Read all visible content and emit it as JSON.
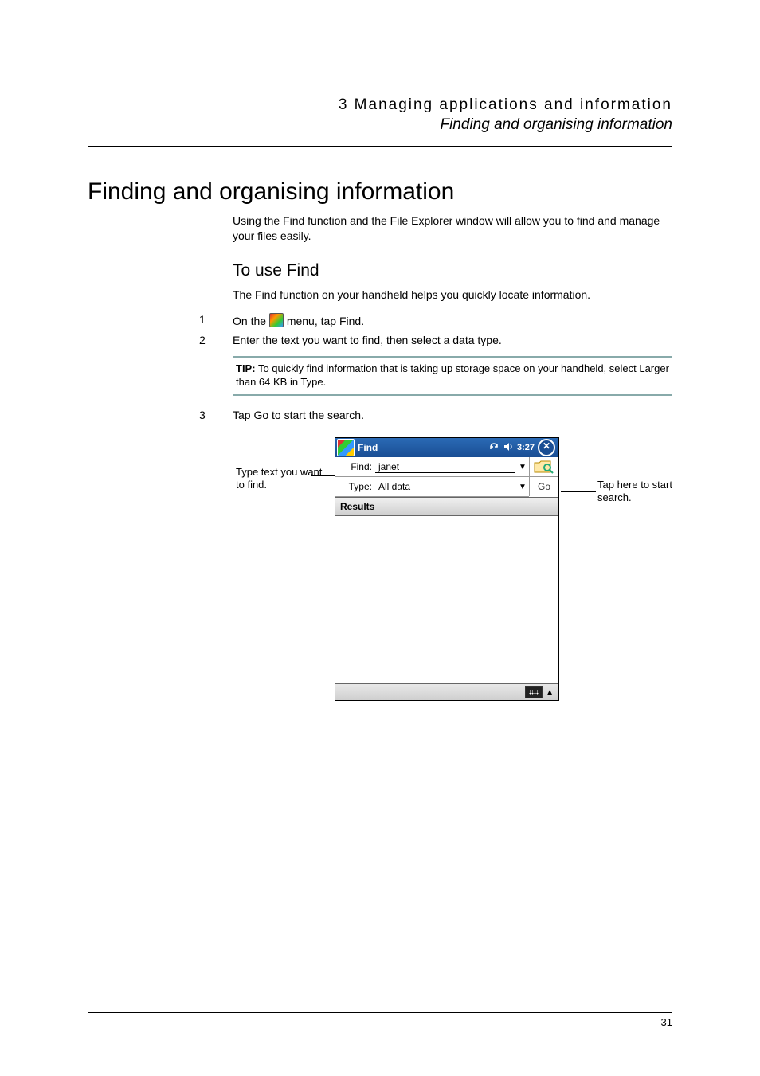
{
  "header": {
    "chapter": "3 Managing applications and information",
    "section": "Finding and organising information"
  },
  "heading": "Finding and organising information",
  "intro": "Using the Find function and the File Explorer window will allow you to find and manage your files easily.",
  "sub": {
    "title": "To use Find",
    "desc": "The Find function on your handheld helps you quickly locate information."
  },
  "steps": {
    "n1": "1",
    "t1a": "On the ",
    "t1b": " menu, tap Find.",
    "n2": "2",
    "t2": "Enter the text you want to find, then select a data type.",
    "n3": "3",
    "t3": "Tap Go to start the search."
  },
  "tip": {
    "label": "TIP:",
    "text": "To quickly find information that is taking up storage space on your handheld, select Larger than 64 KB in Type."
  },
  "callouts": {
    "left": "Type text you want to find.",
    "right": "Tap here to start search."
  },
  "device": {
    "title": "Find",
    "time": "3:27",
    "close": "✕",
    "find_label": "Find:",
    "find_value": "janet",
    "type_label": "Type:",
    "type_value": "All data",
    "go": "Go",
    "results": "Results"
  },
  "page_number": "31"
}
